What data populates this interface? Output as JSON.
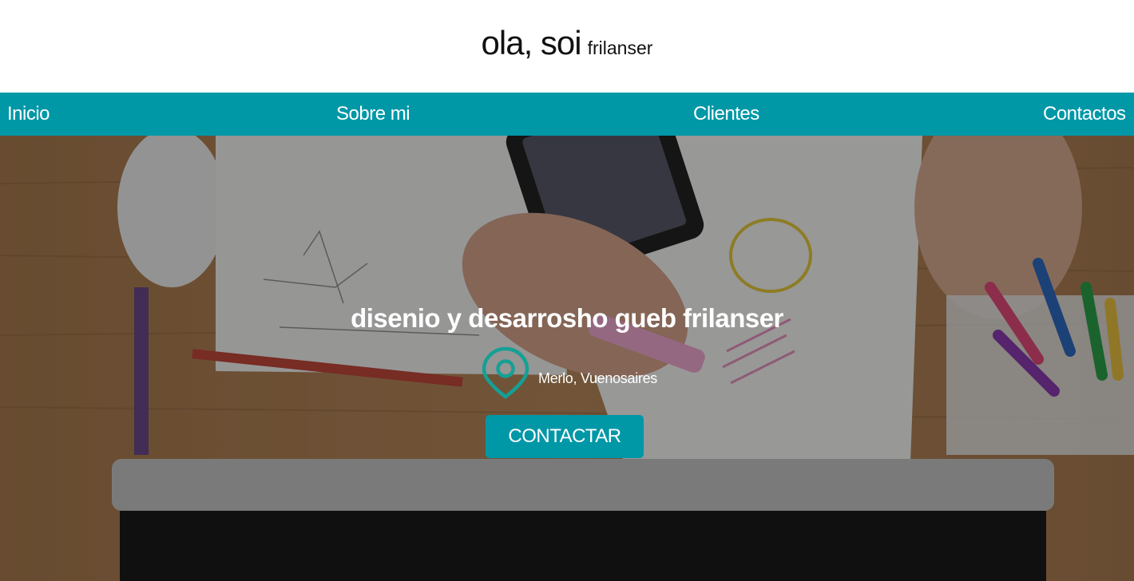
{
  "header": {
    "brand_main": "ola, soi",
    "brand_sub": "frilanser"
  },
  "nav": {
    "items": [
      {
        "label": "Inicio"
      },
      {
        "label": "Sobre mi"
      },
      {
        "label": "Clientes"
      },
      {
        "label": "Contactos"
      }
    ]
  },
  "hero": {
    "title": "disenio y desarrosho gueb frilanser",
    "location_icon": "map-pin-icon",
    "location": "Merlo, Vuenosaires",
    "cta_label": "CONTACTAR"
  },
  "colors": {
    "accent": "#0097a7",
    "pin": "#15a095",
    "header_bg": "#ffffff",
    "text_dark": "#111111",
    "text_light": "#ffffff"
  }
}
